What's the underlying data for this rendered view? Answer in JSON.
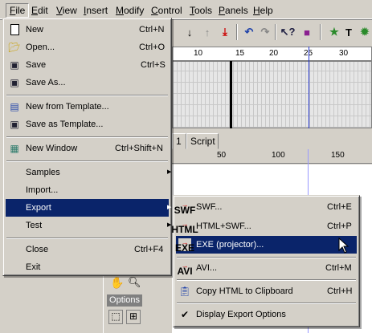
{
  "menubar": {
    "items": [
      {
        "label": "File",
        "key": "F",
        "rest": "ile"
      },
      {
        "label": "Edit",
        "key": "E",
        "rest": "dit"
      },
      {
        "label": "View",
        "key": "V",
        "rest": "iew"
      },
      {
        "label": "Insert",
        "key": "I",
        "rest": "nsert"
      },
      {
        "label": "Modify",
        "key": "M",
        "rest": "odify"
      },
      {
        "label": "Control",
        "key": "C",
        "rest": "ontrol"
      },
      {
        "label": "Tools",
        "key": "T",
        "rest": "ools"
      },
      {
        "label": "Panels",
        "key": "P",
        "rest": "anels"
      },
      {
        "label": "Help",
        "key": "H",
        "rest": "elp"
      }
    ]
  },
  "file_menu": {
    "items": [
      {
        "label": "New",
        "shortcut": "Ctrl+N",
        "icon": "new-document-icon"
      },
      {
        "label": "Open...",
        "shortcut": "Ctrl+O",
        "icon": "open-folder-icon"
      },
      {
        "label": "Save",
        "shortcut": "Ctrl+S",
        "icon": "save-disk-icon"
      },
      {
        "label": "Save As...",
        "shortcut": "",
        "icon": "save-as-icon"
      },
      {
        "label": "New from Template...",
        "shortcut": "",
        "icon": "new-from-template-icon"
      },
      {
        "label": "Save as Template...",
        "shortcut": "",
        "icon": "save-as-template-icon"
      },
      {
        "label": "New Window",
        "shortcut": "Ctrl+Shift+N",
        "icon": "new-window-icon"
      },
      {
        "label": "Samples",
        "shortcut": "",
        "icon": ""
      },
      {
        "label": "Import...",
        "shortcut": "",
        "icon": ""
      },
      {
        "label": "Export",
        "shortcut": "",
        "icon": ""
      },
      {
        "label": "Test",
        "shortcut": "",
        "icon": ""
      },
      {
        "label": "Close",
        "shortcut": "Ctrl+F4",
        "icon": ""
      },
      {
        "label": "Exit",
        "shortcut": "",
        "icon": ""
      }
    ]
  },
  "export_menu": {
    "items": [
      {
        "label": "SWF...",
        "shortcut": "Ctrl+E",
        "icon_text": "SWF"
      },
      {
        "label": "HTML+SWF...",
        "shortcut": "Ctrl+P",
        "icon_text": "HTML"
      },
      {
        "label": "EXE (projector)...",
        "shortcut": "",
        "icon_text": "EXE"
      },
      {
        "label": "AVI...",
        "shortcut": "Ctrl+M",
        "icon_text": "AVI"
      },
      {
        "label": "Copy HTML to Clipboard",
        "shortcut": "Ctrl+H",
        "icon_text": ""
      },
      {
        "label": "Display Export Options",
        "shortcut": "",
        "icon_text": ""
      }
    ],
    "highlighted": "EXE (projector)..."
  },
  "timeline": {
    "frame_numbers": [
      "10",
      "15",
      "20",
      "25",
      "30"
    ],
    "tabs": [
      "1",
      "Script"
    ]
  },
  "stage_ruler": {
    "numbers": [
      "50",
      "100",
      "150"
    ]
  },
  "tools_panel": {
    "options_label": "Options"
  },
  "colors": {
    "highlight": "#0a246a",
    "face": "#d4d0c8",
    "accent_red": "#d00000"
  }
}
